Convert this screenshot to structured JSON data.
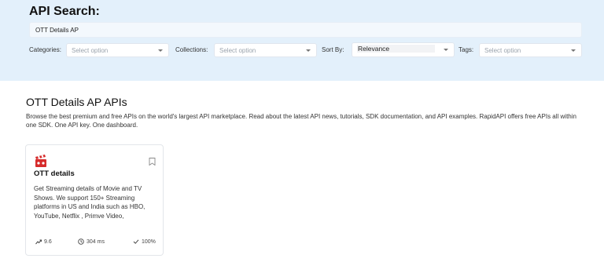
{
  "search": {
    "title": "API Search:",
    "query": "OTT Details AP"
  },
  "filters": {
    "categories_label": "Categories:",
    "categories_placeholder": "Select option",
    "collections_label": "Collections:",
    "collections_placeholder": "Select option",
    "sortby_label": "Sort By:",
    "sortby_value": "Relevance",
    "tags_label": "Tags:",
    "tags_placeholder": "Select option"
  },
  "results": {
    "heading": "OTT Details AP APIs",
    "description": "Browse the best premium and free APIs on the world's largest API marketplace. Read about the latest API news, tutorials, SDK documentation, and API examples. RapidAPI offers free APIs all within one SDK. One API key. One dashboard."
  },
  "cards": [
    {
      "title": "OTT details",
      "description": "Get Streaming details of Movie and TV Shows. We support 150+ Streaming platforms in US and India such as HBO, YouTube, Netflix , Primve Video,",
      "popularity": "9.6",
      "latency": "304 ms",
      "success": "100%",
      "logo_icon": "clapperboard-icon",
      "logo_color": "#d62b2b"
    }
  ],
  "colors": {
    "panel_bg": "#e3f0fb",
    "accent": "#d62b2b"
  }
}
